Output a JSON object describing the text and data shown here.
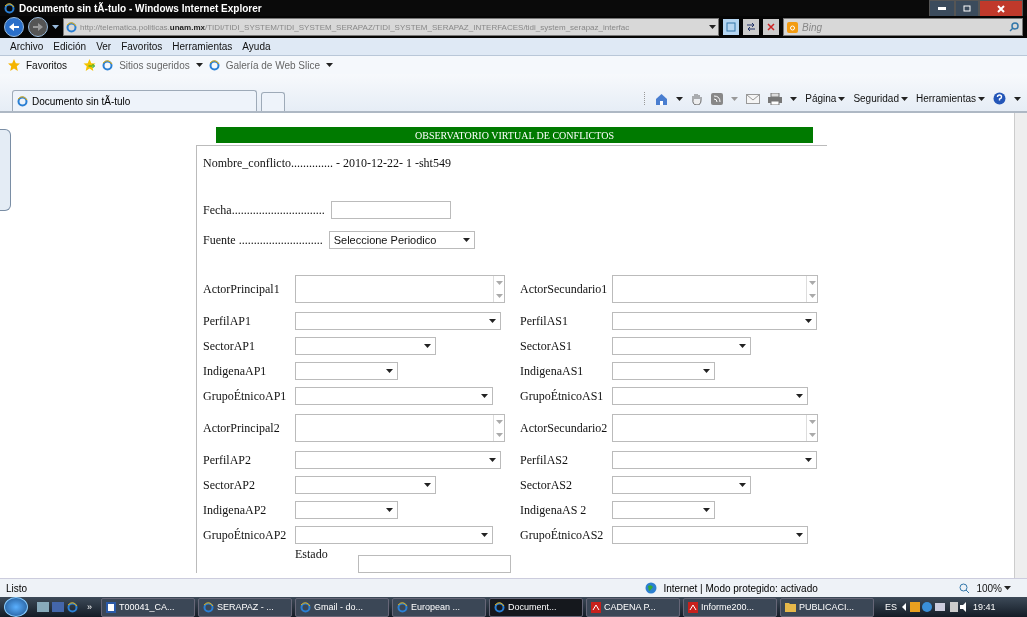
{
  "window": {
    "title": "Documento sin tÃ-tulo - Windows Internet Explorer"
  },
  "address_bar": {
    "url": "http://telematica.politicas.**unam.mx**/TIDI/TIDI_SYSTEM/TIDI_SYSTEM_SERAPAZ/TIDI_SYSTEM_SERAPAZ_INTERFACES/tidi_system_serapaz_interfac",
    "search_placeholder": "Bing"
  },
  "menu": [
    "Archivo",
    "Edición",
    "Ver",
    "Favoritos",
    "Herramientas",
    "Ayuda"
  ],
  "favorites_bar": {
    "favorites": "Favoritos",
    "links": [
      "Sitios sugeridos",
      "Galería de Web Slice"
    ]
  },
  "tabs": [
    {
      "label": "Documento sin tÃ-tulo",
      "selected": true
    }
  ],
  "command_bar": [
    "Página",
    "Seguridad",
    "Herramientas"
  ],
  "page": {
    "header": "OBSERVATORIO VIRTUAL DE CONFLICTOS",
    "nombre_conflicto": "Nombre_conflicto.............. - 2010-12-22- 1 -sht549",
    "fecha": {
      "label": "Fecha..............................."
    },
    "fuente": {
      "label": "Fuente ............................",
      "value": "Seleccione Periodico"
    },
    "rows": [
      {
        "left": {
          "label": "ActorPrincipal1",
          "kind": "textarea"
        },
        "right": {
          "label": "ActorSecundario1",
          "kind": "textarea"
        }
      },
      {
        "left": {
          "label": "PerfilAP1",
          "kind": "select"
        },
        "right": {
          "label": "PerfilAS1",
          "kind": "select"
        }
      },
      {
        "left": {
          "label": "SectorAP1",
          "kind": "select"
        },
        "right": {
          "label": "SectorAS1",
          "kind": "select"
        }
      },
      {
        "left": {
          "label": "IndigenaAP1",
          "kind": "select"
        },
        "right": {
          "label": "IndigenaAS1",
          "kind": "select"
        }
      },
      {
        "left": {
          "label": "GrupoÉtnicoAP1",
          "kind": "select"
        },
        "right": {
          "label": "GrupoÉtnicoAS1",
          "kind": "select"
        }
      },
      {
        "left": {
          "label": "ActorPrincipal2",
          "kind": "textarea"
        },
        "right": {
          "label": "ActorSecundario2",
          "kind": "textarea"
        }
      },
      {
        "left": {
          "label": "PerfilAP2",
          "kind": "select"
        },
        "right": {
          "label": "PerfilAS2",
          "kind": "select"
        }
      },
      {
        "left": {
          "label": "SectorAP2",
          "kind": "select"
        },
        "right": {
          "label": "SectorAS2",
          "kind": "select"
        }
      },
      {
        "left": {
          "label": "IndigenaAP2",
          "kind": "select"
        },
        "right": {
          "label": "IndigenaAS 2",
          "kind": "select"
        }
      },
      {
        "left": {
          "label": "GrupoÉtnicoAP2",
          "kind": "select"
        },
        "right": {
          "label": "GrupoÉtnicoAS2",
          "kind": "select"
        }
      }
    ],
    "estado": {
      "label": "Estado"
    }
  },
  "status_bar": {
    "text": "Listo",
    "zone": "Internet | Modo protegido: activado",
    "zoom": "100%"
  },
  "taskbar": {
    "items": [
      {
        "label": "T00041_CA...",
        "kind": "doc",
        "selected": false
      },
      {
        "label": "SERAPAZ - ...",
        "kind": "ie",
        "selected": false
      },
      {
        "label": "Gmail - do...",
        "kind": "ie",
        "selected": false
      },
      {
        "label": "European ...",
        "kind": "ie",
        "selected": false
      },
      {
        "label": "Document...",
        "kind": "ie",
        "selected": true
      },
      {
        "label": "CADENA P...",
        "kind": "pdf",
        "selected": false
      },
      {
        "label": "Informe200...",
        "kind": "pdf",
        "selected": false
      },
      {
        "label": "PUBLICACI...",
        "kind": "folder",
        "selected": false
      }
    ],
    "overflow": "»",
    "language": "ES",
    "time": "19:41"
  }
}
